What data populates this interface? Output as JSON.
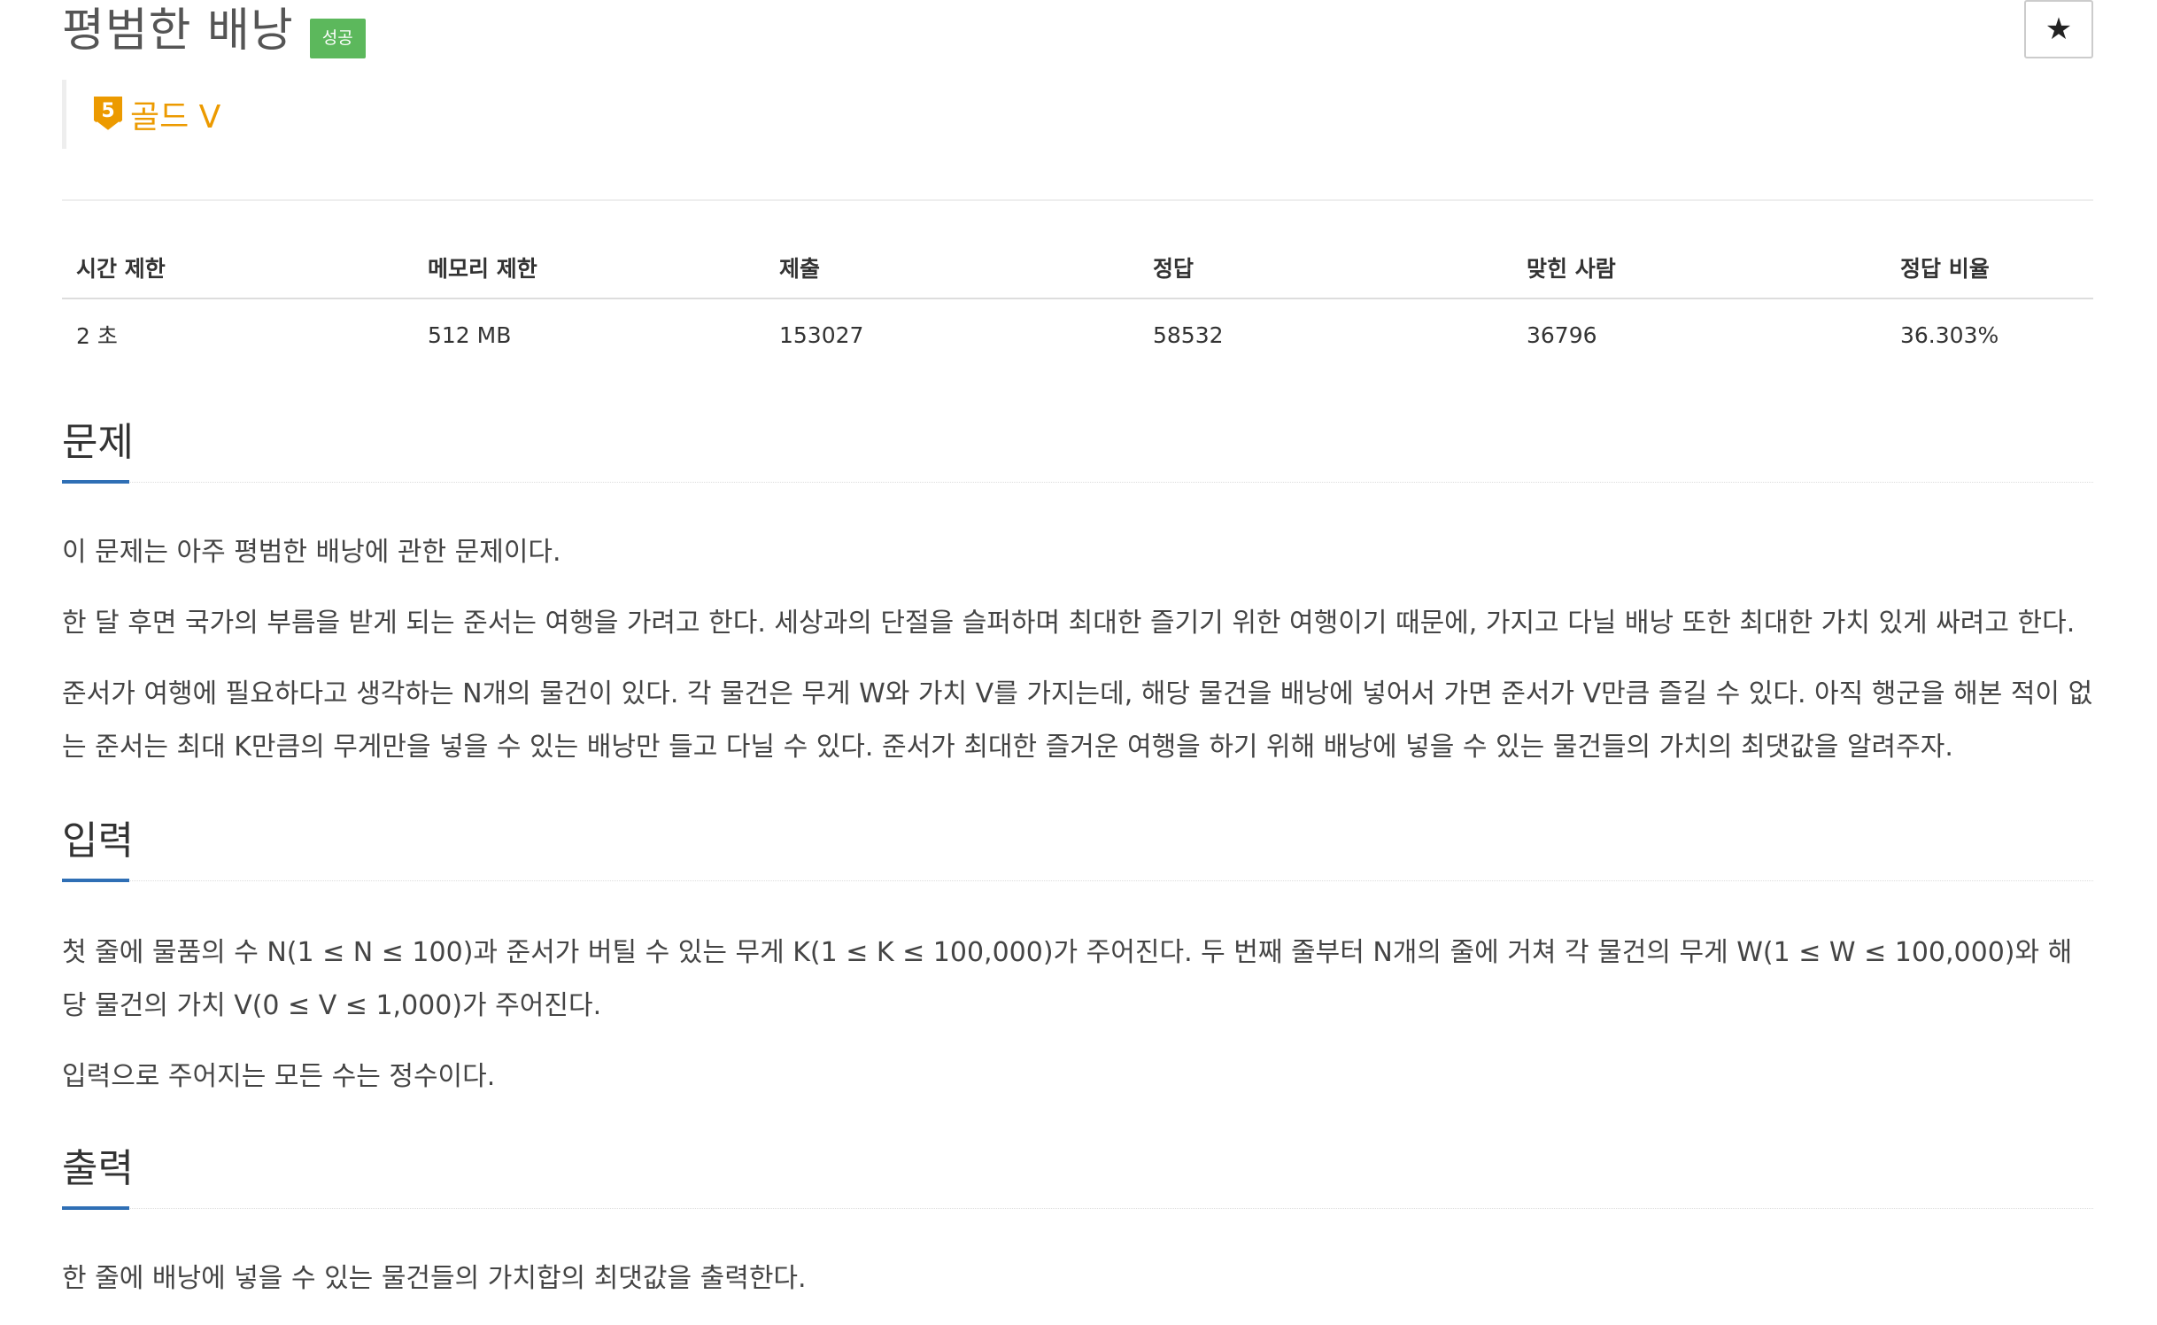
{
  "header": {
    "title": "평범한 배낭",
    "result_badge": "성공",
    "star_icon": "★",
    "tier": {
      "number": "5",
      "label": "골드 V",
      "color": "#ec9a00"
    }
  },
  "info": {
    "headers": [
      "시간 제한",
      "메모리 제한",
      "제출",
      "정답",
      "맞힌 사람",
      "정답 비율"
    ],
    "values": [
      "2 초",
      "512 MB",
      "153027",
      "58532",
      "36796",
      "36.303%"
    ]
  },
  "sections": {
    "problem": {
      "title": "문제",
      "paragraphs": [
        "이 문제는 아주 평범한 배낭에 관한 문제이다.",
        "한 달 후면 국가의 부름을 받게 되는 준서는 여행을 가려고 한다. 세상과의 단절을 슬퍼하며 최대한 즐기기 위한 여행이기 때문에, 가지고 다닐 배낭 또한 최대한 가치 있게 싸려고 한다.",
        "준서가 여행에 필요하다고 생각하는 N개의 물건이 있다. 각 물건은 무게 W와 가치 V를 가지는데, 해당 물건을 배낭에 넣어서 가면 준서가 V만큼 즐길 수 있다. 아직 행군을 해본 적이 없는 준서는 최대 K만큼의 무게만을 넣을 수 있는 배낭만 들고 다닐 수 있다. 준서가 최대한 즐거운 여행을 하기 위해 배낭에 넣을 수 있는 물건들의 가치의 최댓값을 알려주자."
      ]
    },
    "input": {
      "title": "입력",
      "paragraphs": [
        "첫 줄에 물품의 수 N(1 ≤ N ≤ 100)과 준서가 버틸 수 있는 무게 K(1 ≤ K ≤ 100,000)가 주어진다. 두 번째 줄부터 N개의 줄에 거쳐 각 물건의 무게 W(1 ≤ W ≤ 100,000)와 해당 물건의 가치 V(0 ≤ V ≤ 1,000)가 주어진다.",
        "입력으로 주어지는 모든 수는 정수이다."
      ]
    },
    "output": {
      "title": "출력",
      "paragraphs": [
        "한 줄에 배낭에 넣을 수 있는 물건들의 가치합의 최댓값을 출력한다."
      ]
    }
  },
  "colors": {
    "badge_success": "#5cb85c",
    "section_accent": "#2f6fb5",
    "tier_gold": "#ec9a00"
  }
}
